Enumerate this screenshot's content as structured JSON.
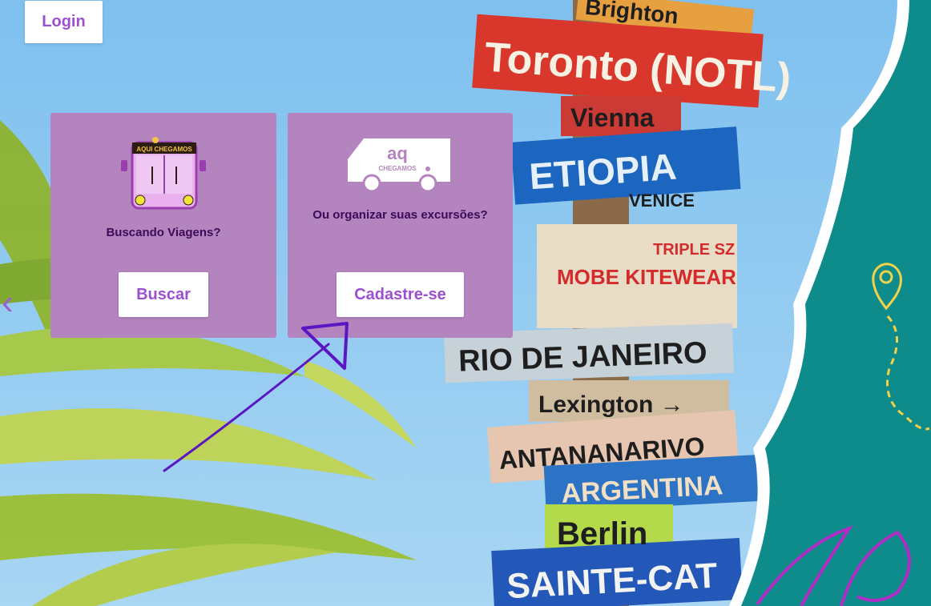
{
  "header": {
    "login_label": "Login"
  },
  "cards": [
    {
      "icon": "bus-icon",
      "icon_text": "AQUI CHEGAMOS",
      "caption": "Buscando Viagens?",
      "button_label": "Buscar"
    },
    {
      "icon": "van-icon",
      "icon_text": "CHEGAMOS",
      "caption": "Ou organizar suas excursões?",
      "button_label": "Cadastre-se"
    }
  ],
  "carousel": {
    "prev_icon": "chevron-left-icon",
    "prev_glyph": "‹"
  },
  "background": {
    "signs": [
      "Brighton",
      "Toronto (NOTL)",
      "Vienna",
      "ETIOPIA",
      "VENICE",
      "MOBE KITEWEAR",
      "TRIPLE SZ",
      "RIO DE JANEIRO",
      "Lexington",
      "ANTANANARIVO",
      "ARGENTINA",
      "Berlin",
      "SAINTE-CAT"
    ],
    "logo_text": "AQ"
  },
  "colors": {
    "accent": "#9b4fd1",
    "card": "#b384be",
    "teal": "#0e8c8c",
    "sky": "#8ec6ee"
  }
}
